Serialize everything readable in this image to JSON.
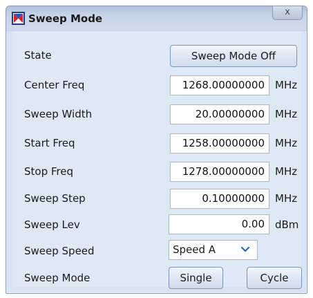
{
  "window": {
    "title": "Sweep Mode",
    "close_label": "x"
  },
  "rows": {
    "state": {
      "label": "State",
      "button": "Sweep Mode Off"
    },
    "center_freq": {
      "label": "Center Freq",
      "value": "1268.00000000",
      "unit": "MHz"
    },
    "sweep_width": {
      "label": "Sweep Width",
      "value": "20.00000000",
      "unit": "MHz"
    },
    "start_freq": {
      "label": "Start Freq",
      "value": "1258.00000000",
      "unit": "MHz"
    },
    "stop_freq": {
      "label": "Stop Freq",
      "value": "1278.00000000",
      "unit": "MHz"
    },
    "sweep_step": {
      "label": "Sweep Step",
      "value": "0.10000000",
      "unit": "MHz"
    },
    "sweep_lev": {
      "label": "Sweep Lev",
      "value": "0.00",
      "unit": "dBm"
    },
    "sweep_speed": {
      "label": "Sweep Speed",
      "selected": "Speed A"
    },
    "sweep_mode": {
      "label": "Sweep Mode",
      "single": "Single",
      "cycle": "Cycle"
    }
  },
  "icons": {
    "app": "app-logo-icon",
    "close": "close-icon",
    "dropdown": "chevron-down-icon"
  },
  "colors": {
    "panel": "#dfe8f5",
    "titlebar": "#c6d4e7",
    "field_border": "#a9b7ca"
  }
}
